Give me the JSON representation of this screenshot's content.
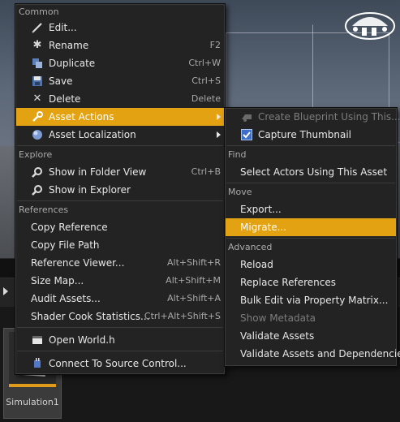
{
  "asset": {
    "name": "Simulation1"
  },
  "main_menu": {
    "sections": {
      "common": "Common",
      "explore": "Explore",
      "references": "References"
    },
    "items": [
      {
        "label": "Edit...",
        "shortcut": "",
        "icon": "pencil-icon"
      },
      {
        "label": "Rename",
        "shortcut": "F2",
        "icon": "asterisk-icon"
      },
      {
        "label": "Duplicate",
        "shortcut": "Ctrl+W",
        "icon": "duplicate-icon"
      },
      {
        "label": "Save",
        "shortcut": "Ctrl+S",
        "icon": "save-icon"
      },
      {
        "label": "Delete",
        "shortcut": "Delete",
        "icon": "x-icon"
      },
      {
        "label": "Asset Actions",
        "shortcut": "",
        "icon": "wrench-icon"
      },
      {
        "label": "Asset Localization",
        "shortcut": "",
        "icon": "globe-icon"
      },
      {
        "label": "Show in Folder View",
        "shortcut": "Ctrl+B",
        "icon": "magnifier-icon"
      },
      {
        "label": "Show in Explorer",
        "shortcut": "",
        "icon": "magnifier-icon"
      },
      {
        "label": "Copy Reference",
        "shortcut": ""
      },
      {
        "label": "Copy File Path",
        "shortcut": ""
      },
      {
        "label": "Reference Viewer...",
        "shortcut": "Alt+Shift+R"
      },
      {
        "label": "Size Map...",
        "shortcut": "Alt+Shift+M"
      },
      {
        "label": "Audit Assets...",
        "shortcut": "Alt+Shift+A"
      },
      {
        "label": "Shader Cook Statistics...",
        "shortcut": "Ctrl+Alt+Shift+S"
      },
      {
        "label": "Open World.h",
        "shortcut": "",
        "icon": "cpp-file-icon"
      },
      {
        "label": "Connect To Source Control...",
        "shortcut": "",
        "icon": "source-control-icon"
      }
    ]
  },
  "sub_menu": {
    "sections": {
      "find": "Find",
      "move": "Move",
      "advanced": "Advanced"
    },
    "items": [
      {
        "label": "Create Blueprint Using This...",
        "icon": "blueprint-icon"
      },
      {
        "label": "Capture Thumbnail",
        "icon": "checkbox-icon"
      },
      {
        "label": "Select Actors Using This Asset"
      },
      {
        "label": "Export..."
      },
      {
        "label": "Migrate..."
      },
      {
        "label": "Reload"
      },
      {
        "label": "Replace References"
      },
      {
        "label": "Bulk Edit via Property Matrix..."
      },
      {
        "label": "Show Metadata"
      },
      {
        "label": "Validate Assets"
      },
      {
        "label": "Validate Assets and Dependencies"
      }
    ]
  },
  "colors": {
    "highlight": "#e3a212",
    "menu_bg": "#232323",
    "disabled_text": "#7c7c7c"
  }
}
